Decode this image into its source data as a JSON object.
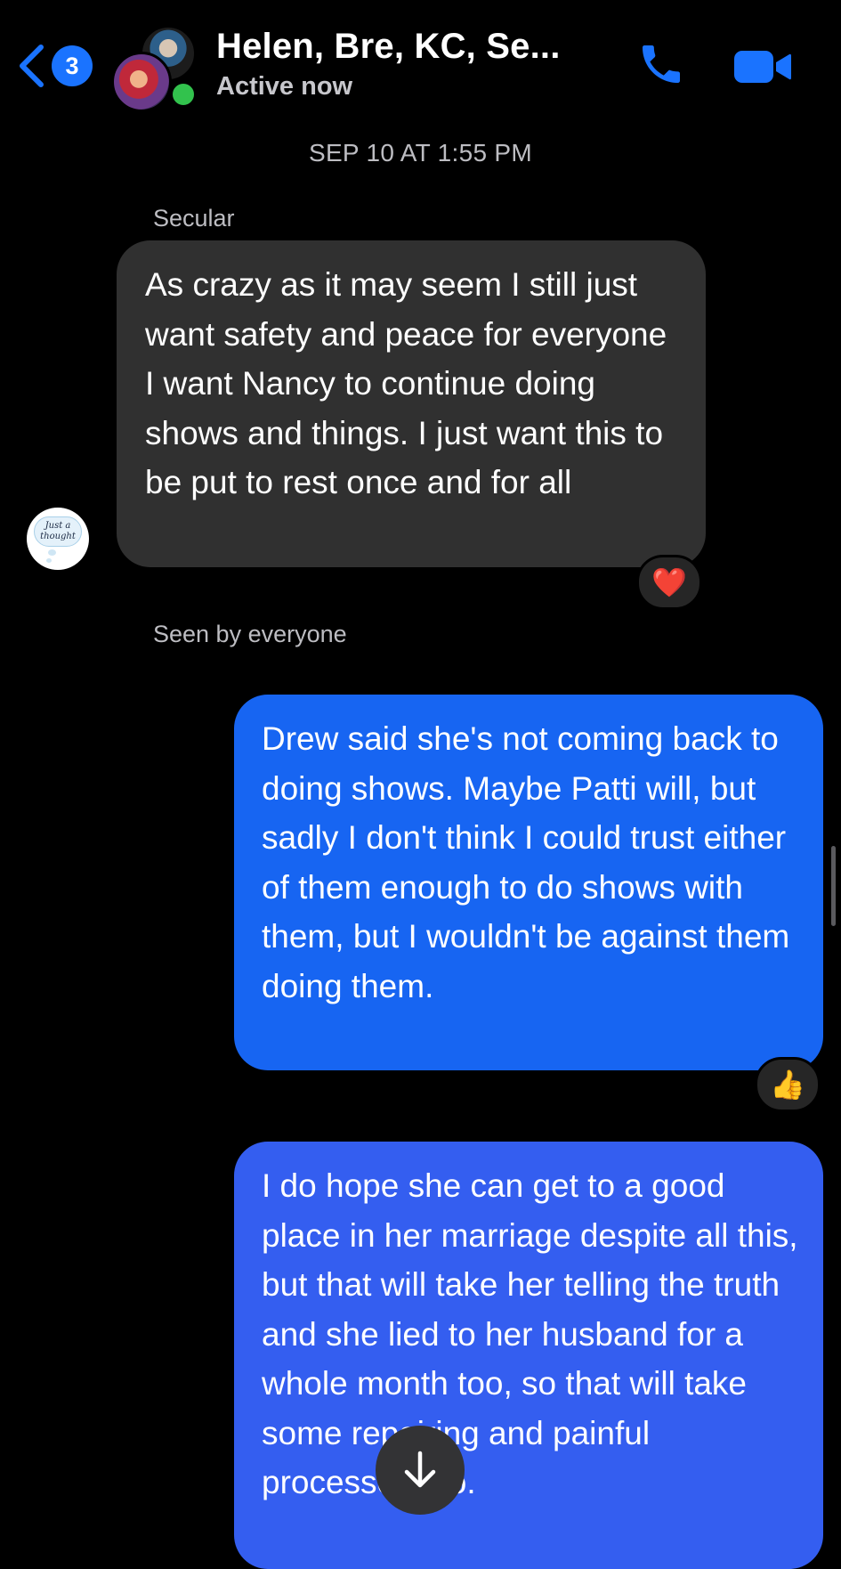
{
  "header": {
    "unread_count": "3",
    "title": "Helen, Bre, KC, Se...",
    "status": "Active now",
    "icons": {
      "back": "chevron-left-icon",
      "call": "phone-icon",
      "video": "video-camera-icon"
    },
    "accent_color": "#1a73ff",
    "online_color": "#32c24d"
  },
  "conversation": {
    "timestamp": "SEP 10 AT 1:55 PM",
    "incoming": {
      "sender": "Secular",
      "avatar_text": "Just a thought",
      "text": "As crazy as it may seem I still just want safety and peace for everyone I want Nancy to continue doing shows and things. I just want this to be put to rest once and for all",
      "reaction": "❤️"
    },
    "seen_text": "Seen by everyone",
    "outgoing": [
      {
        "text": "Drew said she's not coming back to doing shows. Maybe Patti will, but sadly I don't think I could trust either of them enough to do shows with them, but I wouldn't be against them doing them.",
        "reaction": "👍"
      },
      {
        "text": "I do hope she can get to a good place in her marriage despite all this, but that will take her telling the truth and she lied to her husband for a whole month too, so that will take some repairing and painful processes too."
      }
    ]
  },
  "colors": {
    "background": "#000000",
    "incoming_bubble": "#303030",
    "outgoing_bubble_1": "#1765f2",
    "outgoing_bubble_2": "#345ef0"
  },
  "scroll_button_icon": "arrow-down-icon"
}
